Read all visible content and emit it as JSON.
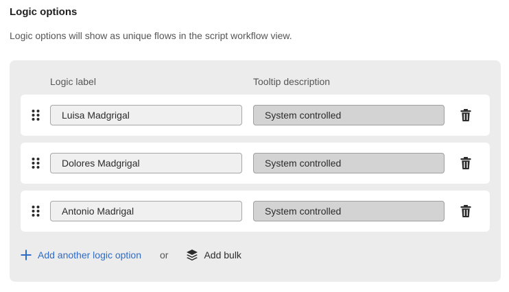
{
  "section": {
    "title": "Logic options",
    "description": "Logic options will show as unique flows in the script workflow view."
  },
  "columns": {
    "label_header": "Logic label",
    "tooltip_header": "Tooltip description"
  },
  "rows": [
    {
      "label_value": "Luisa Madgrigal",
      "tooltip_value": "System controlled"
    },
    {
      "label_value": "Dolores Madgrigal",
      "tooltip_value": "System controlled"
    },
    {
      "label_value": "Antonio Madrigal",
      "tooltip_value": "System controlled"
    }
  ],
  "footer": {
    "add_label": "Add another logic option",
    "or_label": "or",
    "bulk_label": "Add bulk"
  },
  "icons": {
    "drag": "drag-handle-icon",
    "delete": "trash-icon",
    "add": "plus-icon",
    "bulk": "layers-icon"
  },
  "colors": {
    "accent": "#2e6bc6",
    "panel_bg": "#ececec",
    "disabled_input_bg": "#d3d3d3"
  }
}
